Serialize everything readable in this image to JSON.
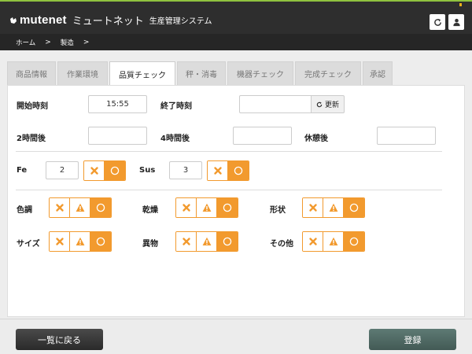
{
  "header": {
    "logo_text": "mutenet",
    "logo_kana": "ミュートネット",
    "system_name": "生産管理システム"
  },
  "breadcrumb": [
    {
      "label": "ホーム"
    },
    {
      "label": "製造"
    }
  ],
  "breadcrumb_separator": ">",
  "tabs": [
    {
      "label": "商品情報",
      "active": false
    },
    {
      "label": "作業環境",
      "active": false
    },
    {
      "label": "品質チェック",
      "active": true
    },
    {
      "label": "秤・消毒",
      "active": false
    },
    {
      "label": "機器チェック",
      "active": false
    },
    {
      "label": "完成チェック",
      "active": false
    },
    {
      "label": "承認",
      "active": false
    }
  ],
  "form": {
    "start_time_label": "開始時刻",
    "start_time_value": "15:55",
    "end_time_label": "終了時刻",
    "end_time_value": "",
    "refresh_label": "更新",
    "after2h_label": "2時間後",
    "after2h_value": "",
    "after4h_label": "4時間後",
    "after4h_value": "",
    "after_break_label": "休憩後",
    "after_break_value": "",
    "fe_label": "Fe",
    "fe_value": "2",
    "sus_label": "Sus",
    "sus_value": "3"
  },
  "checks": [
    {
      "label": "色調",
      "selected": "ok"
    },
    {
      "label": "乾燥",
      "selected": "ok"
    },
    {
      "label": "形状",
      "selected": "ok"
    },
    {
      "label": "サイズ",
      "selected": "ok"
    },
    {
      "label": "異物",
      "selected": "ok"
    },
    {
      "label": "その他",
      "selected": "ok"
    }
  ],
  "metal_checks": {
    "fe_selected": "ok",
    "sus_selected": "ok"
  },
  "footer": {
    "back_label": "一覧に戻る",
    "register_label": "登録"
  },
  "colors": {
    "accent": "#f29a2e",
    "topbar": "#2e2e2e",
    "register": "#4f6964",
    "logo_green": "#8fc23f"
  }
}
